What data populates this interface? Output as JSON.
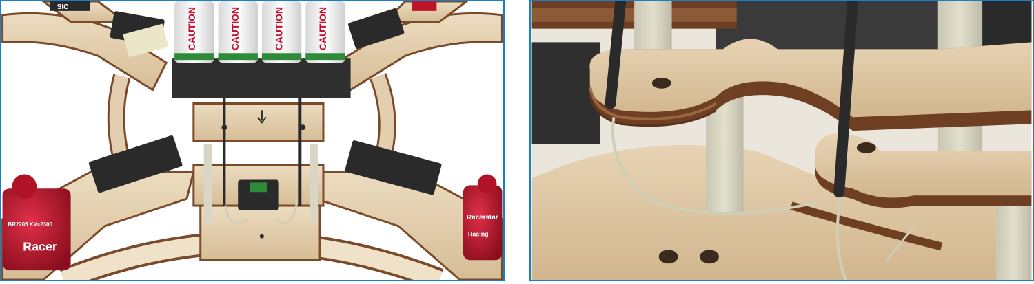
{
  "left_panel": {
    "batteries": [
      {
        "label": "CAUTION"
      },
      {
        "label": "CAUTION"
      },
      {
        "label": "CAUTION"
      },
      {
        "label": "CAUTION"
      }
    ],
    "motor_left": {
      "brand": "Racer",
      "spec": "BR2205 KV=2300"
    },
    "motor_right": {
      "brand": "Racerstar",
      "spec": "Racing"
    },
    "top_corner_text": "SIC"
  },
  "right_panel": {},
  "colors": {
    "frame_border": "#1a7fc4",
    "plywood_face": "#e3cfb0",
    "plywood_edge": "#7a4a2a",
    "battery_green": "#2e8b3a",
    "motor_red": "#c0142a",
    "wire_gray": "#cfcfb8",
    "post_color": "#d9d6c6",
    "esc_black": "#2a2a2a"
  }
}
